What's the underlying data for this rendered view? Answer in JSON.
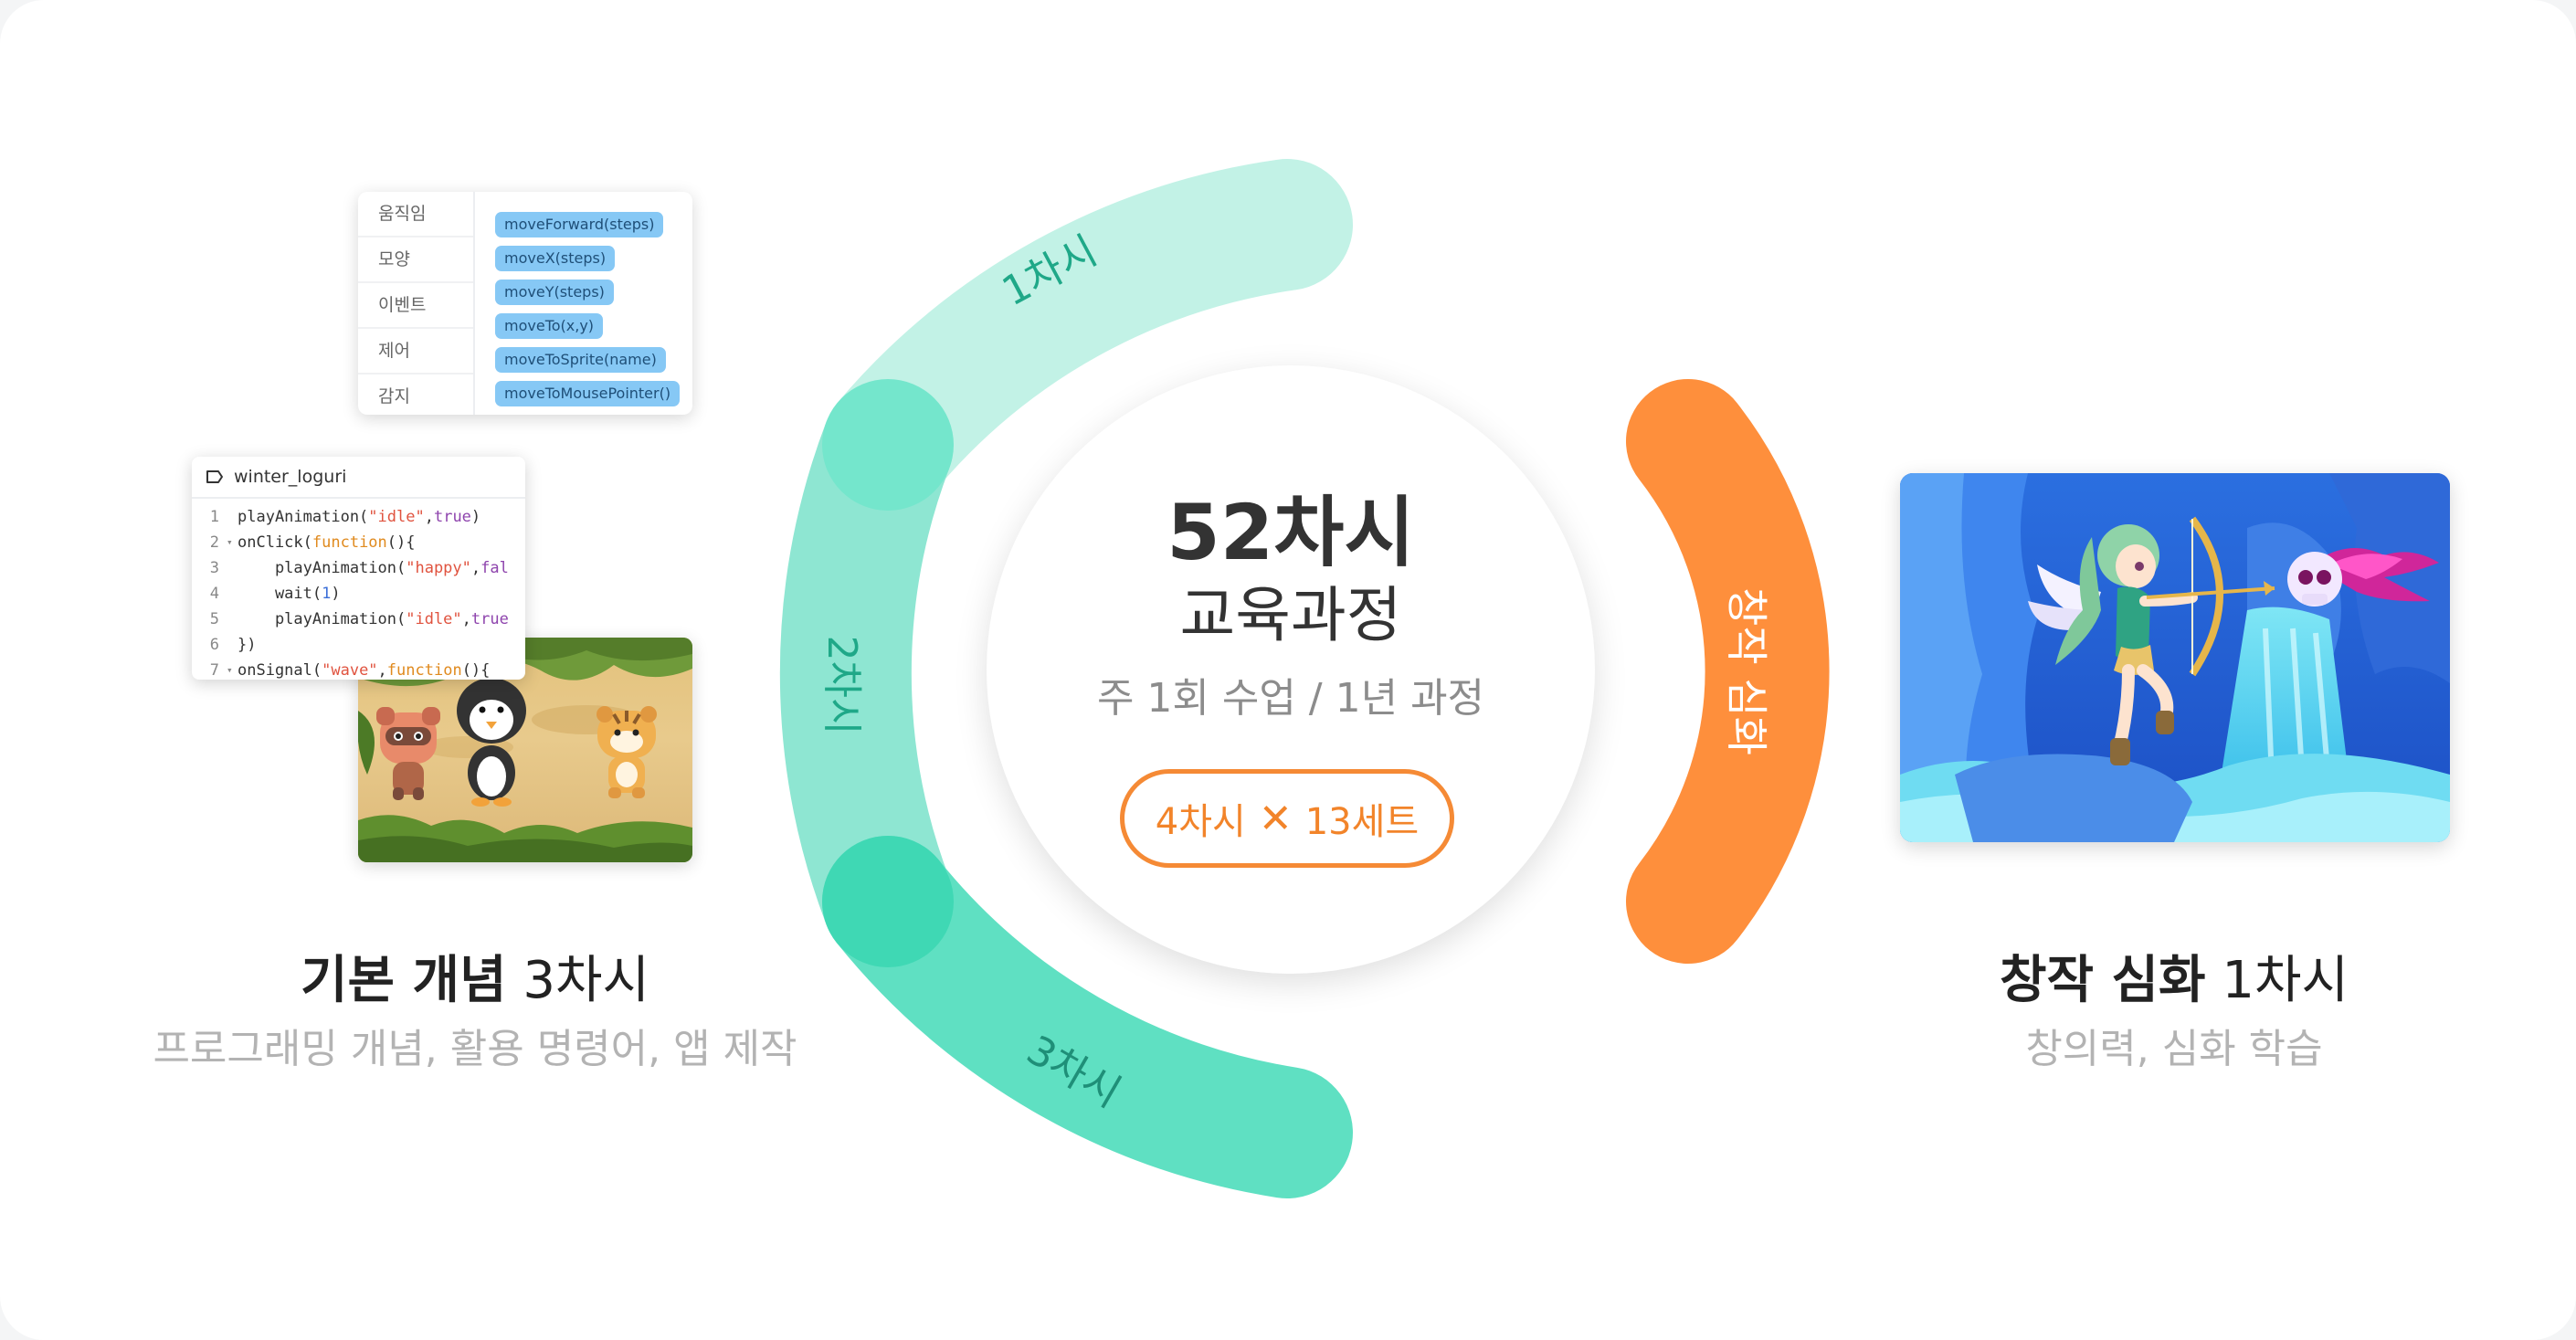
{
  "left": {
    "palette": {
      "categories": [
        "움직임",
        "모양",
        "이벤트",
        "제어",
        "감지"
      ],
      "blocks": [
        "moveForward(steps)",
        "moveX(steps)",
        "moveY(steps)",
        "moveTo(x,y)",
        "moveToSprite(name)",
        "moveToMousePointer()"
      ]
    },
    "editor": {
      "filename": "winter_loguri",
      "lines": [
        {
          "n": "1",
          "fold": "",
          "tokens": [
            [
              "fn",
              "playAnimation("
            ],
            [
              "str",
              "\"idle\""
            ],
            [
              "fn",
              ","
            ],
            [
              "bool",
              "true"
            ],
            [
              "fn",
              ")"
            ]
          ]
        },
        {
          "n": "2",
          "fold": "▾",
          "tokens": [
            [
              "fn",
              "onClick("
            ],
            [
              "kw",
              "function"
            ],
            [
              "fn",
              "(){"
            ]
          ]
        },
        {
          "n": "3",
          "fold": "",
          "tokens": [
            [
              "fn",
              "    playAnimation("
            ],
            [
              "str",
              "\"happy\""
            ],
            [
              "fn",
              ","
            ],
            [
              "bool",
              "fal"
            ]
          ]
        },
        {
          "n": "4",
          "fold": "",
          "tokens": [
            [
              "fn",
              "    wait("
            ],
            [
              "num",
              "1"
            ],
            [
              "fn",
              ")"
            ]
          ]
        },
        {
          "n": "5",
          "fold": "",
          "tokens": [
            [
              "fn",
              "    playAnimation("
            ],
            [
              "str",
              "\"idle\""
            ],
            [
              "fn",
              ","
            ],
            [
              "bool",
              "true"
            ]
          ]
        },
        {
          "n": "6",
          "fold": "",
          "tokens": [
            [
              "fn",
              "})"
            ]
          ]
        },
        {
          "n": "7",
          "fold": "▾",
          "tokens": [
            [
              "fn",
              "onSignal("
            ],
            [
              "str",
              "\"wave\""
            ],
            [
              "fn",
              ","
            ],
            [
              "kw",
              "function"
            ],
            [
              "fn",
              "(){"
            ]
          ]
        }
      ]
    },
    "title_bold": "기본 개념",
    "title_rest": " 3차시",
    "subtitle": "프로그래밍 개념, 활용 명령어, 앱 제작"
  },
  "center": {
    "hours": "52차시",
    "course": "교육과정",
    "weekly": "주 1회 수업 / 1년 과정",
    "pill_left": "4차시",
    "pill_x": "✕",
    "pill_right": "13세트"
  },
  "ring_labels": {
    "first": "1차시",
    "second": "2차시",
    "third": "3차시",
    "creative": "창작 심화"
  },
  "right": {
    "title_bold": "창작 심화",
    "title_rest": " 1차시",
    "subtitle": "창의력, 심화 학습"
  },
  "colors": {
    "teal_light": "#c2f2e6",
    "teal_mid": "#8ee6d2",
    "teal_strong": "#59dfbf",
    "teal_text": "#1fa888",
    "orange": "#fe8f3c",
    "white": "#ffffff"
  }
}
